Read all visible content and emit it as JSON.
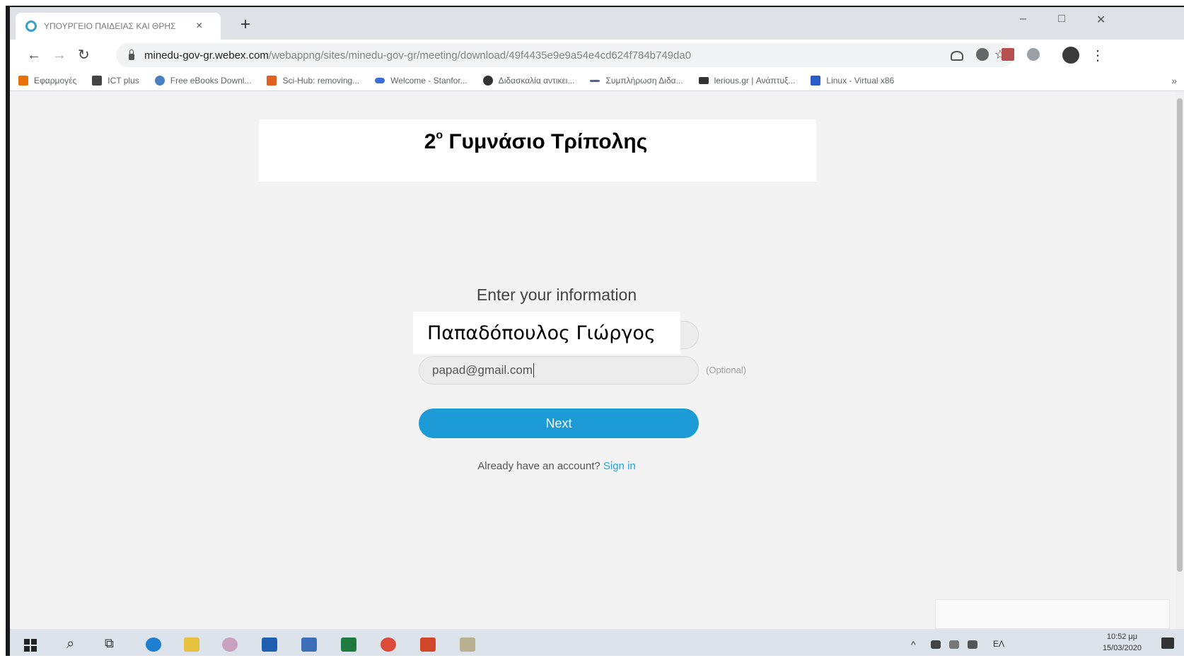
{
  "browser": {
    "tab_title": "ΥΠΟΥΡΓΕΙΟ ΠΑΙΔΕΙΑΣ ΚΑΙ ΘΡΗΣ",
    "tab_close": "×",
    "new_tab": "+",
    "window_controls": {
      "minimize": "–",
      "maximize": "□",
      "close": "✕"
    },
    "url_host": "minedu-gov-gr.webex.com",
    "url_path": "/webappng/sites/minedu-gov-gr/meeting/download/49f4435e9e9a54e4cd624f784b749da0",
    "bookmarks": [
      {
        "label": "Εφαρμογές",
        "icon": "apps-grid-icon",
        "color": "#e8710a"
      },
      {
        "label": "ICT plus",
        "icon": "ict-icon",
        "color": "#444444"
      },
      {
        "label": "Free eBooks Downl...",
        "icon": "ebooks-icon",
        "color": "#4a7fc1"
      },
      {
        "label": "Sci-Hub: removing...",
        "icon": "scihub-icon",
        "color": "#e06020"
      },
      {
        "label": "Welcome - Stanfor...",
        "icon": "stanford-icon",
        "color": "#3b6fd8"
      },
      {
        "label": "Διδασκαλία αντικει...",
        "icon": "globe-icon",
        "color": "#333333"
      },
      {
        "label": "Συμπλήρωση Διδα...",
        "icon": "dash-icon",
        "color": "#5060a0"
      },
      {
        "label": "lerious.gr | Ανάπτυξ...",
        "icon": "lerious-icon",
        "color": "#333333"
      },
      {
        "label": "Linux - Virtual x86",
        "icon": "linux-icon",
        "color": "#2a5cc8"
      }
    ],
    "bookmarks_more": "»"
  },
  "page": {
    "banner_title_num": "2",
    "banner_title_sup": "ο",
    "banner_title_rest": " Γυμνάσιο Τρίπολης",
    "form_heading": "Enter your information",
    "name_value": "Παπαδόπουλος Γιώργος",
    "email_value": "papad@gmail.com",
    "optional_label": "(Optional)",
    "next_label": "Next",
    "account_prompt": "Already have an account?",
    "signin_label": "Sign in"
  },
  "taskbar": {
    "language": "ΕΛ",
    "time": "10:52 μμ",
    "date": "15/03/2020"
  },
  "colors": {
    "accent": "#1d9bd6",
    "link": "#29a3d9",
    "page_bg": "#f3f3f3"
  }
}
